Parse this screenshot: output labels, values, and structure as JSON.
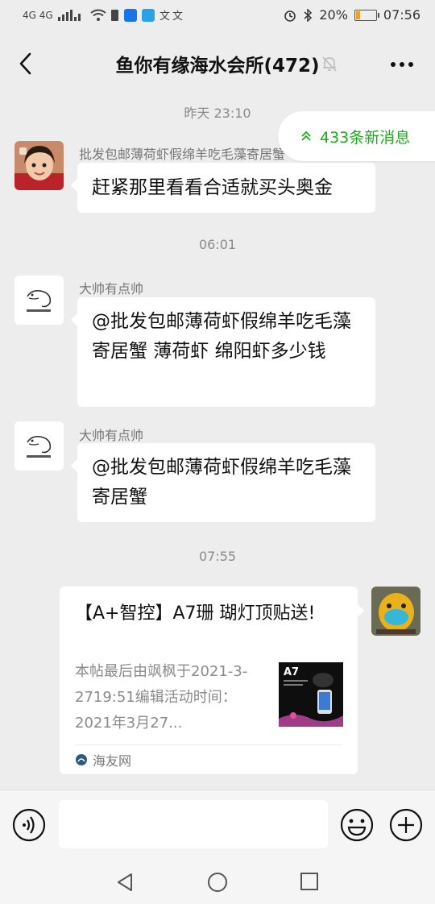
{
  "status_bar": {
    "left_indicators": "4G  4G",
    "battery_percent": "20%",
    "time": "07:56",
    "battery_level": 0.2
  },
  "header": {
    "title": "鱼你有缘海水会所(472)"
  },
  "new_messages_badge": "433条新消息",
  "messages": [
    {
      "time": "昨天 23:10"
    },
    {
      "sender": "批发包邮薄荷虾假绵羊吃毛藻寄居蟹",
      "text": "赶紧那里看看合适就买头奥金"
    },
    {
      "time": "06:01"
    },
    {
      "sender": "大帅有点帅",
      "text": "@批发包邮薄荷虾假绵羊吃毛藻寄居蟹  薄荷虾 绵阳虾多少钱"
    },
    {
      "sender": "大帅有点帅",
      "text": "@批发包邮薄荷虾假绵羊吃毛藻寄居蟹"
    },
    {
      "time": "07:55"
    }
  ],
  "card": {
    "title": "【A+智控】A7珊 瑚灯顶贴送!",
    "description": "本帖最后由飒枫于2021-3-2719:51编辑活动时间：2021年3月27...",
    "thumb_label": "A7",
    "source": "海友网"
  },
  "colors": {
    "background": "#ededed",
    "accent_green": "#1aad19"
  }
}
